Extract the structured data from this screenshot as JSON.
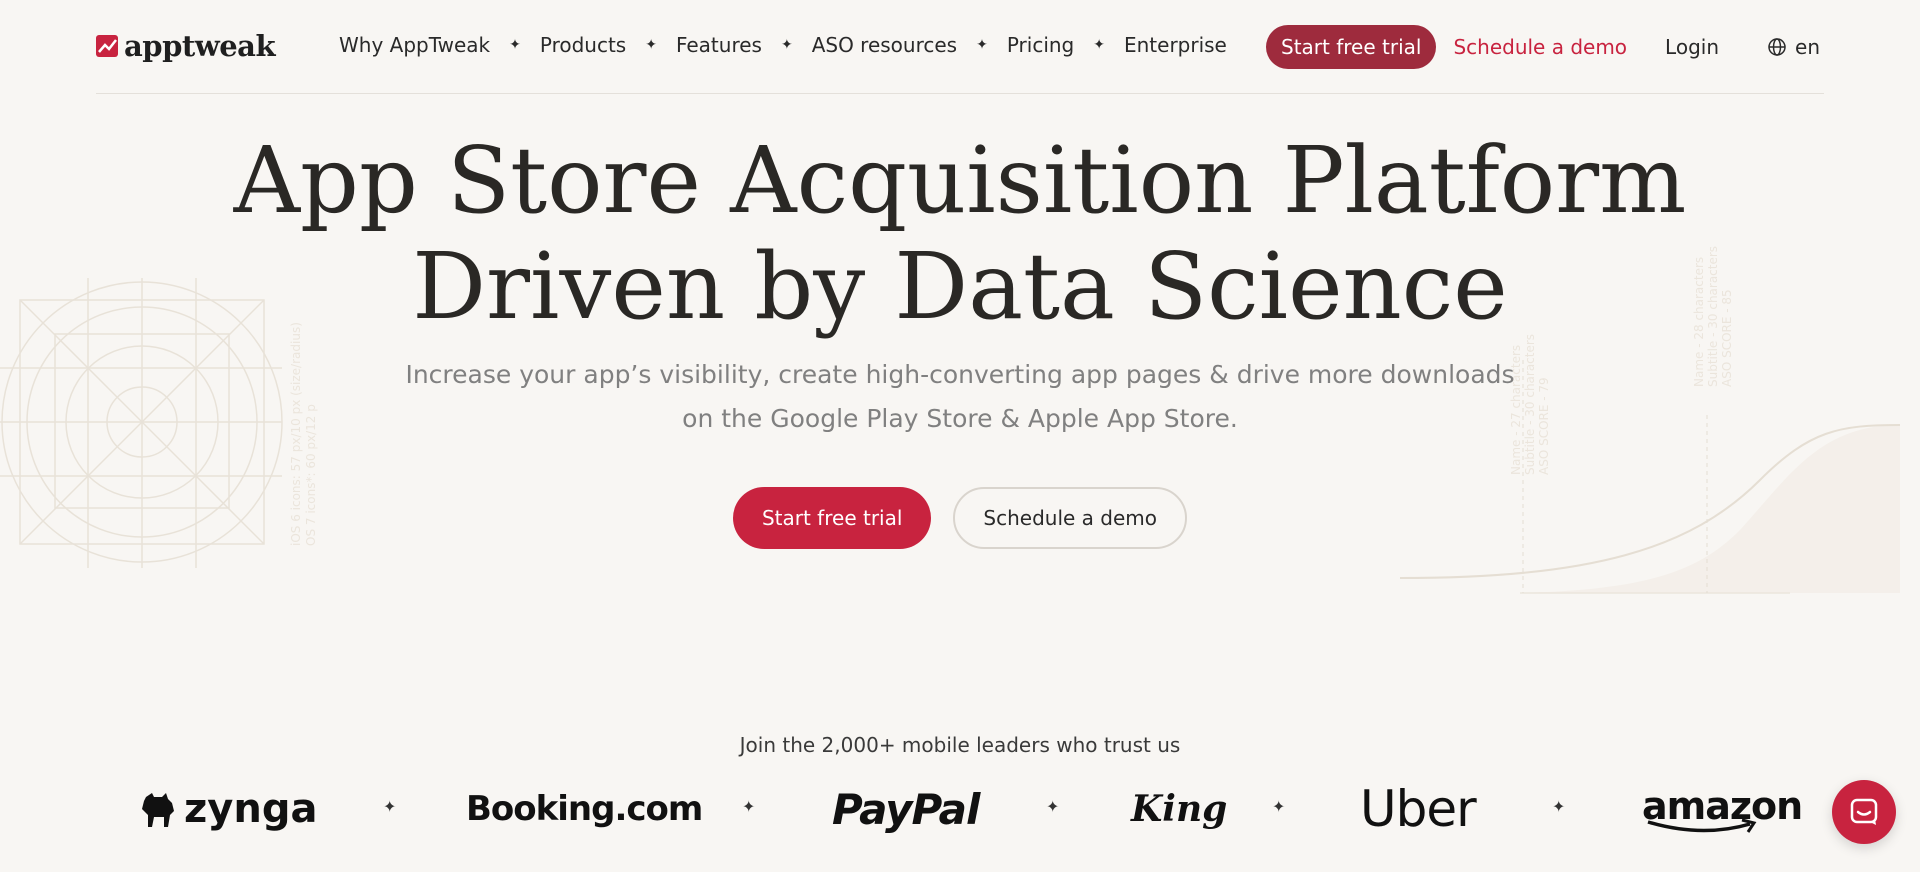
{
  "brand": {
    "name": "apptweak",
    "accent": "#c8233f",
    "accent_dark": "#9e2b3d"
  },
  "nav": {
    "items": [
      {
        "label": "Why AppTweak"
      },
      {
        "label": "Products"
      },
      {
        "label": "Features"
      },
      {
        "label": "ASO resources"
      },
      {
        "label": "Pricing"
      },
      {
        "label": "Enterprise"
      }
    ],
    "separator": "✦",
    "trial_label": "Start free trial",
    "demo_label": "Schedule a demo",
    "login_label": "Login",
    "language": "en"
  },
  "hero": {
    "title_lines": [
      "App Store Acquisition Platform",
      "Driven by Data Science"
    ],
    "subtitle_lines": [
      "Increase your app’s visibility, create high-converting app pages & drive more downloads",
      "on the Google Play Store & Apple App Store."
    ],
    "primary_cta": "Start free trial",
    "secondary_cta": "Schedule a demo"
  },
  "decor": {
    "left_vertical_lines": [
      "iOS 6 icons: 57 px/10 px (size/radius)",
      "OS 7 icons*: 60 px/12 p"
    ],
    "right_col_a": [
      "Name - 27 characters",
      "Subtitle - 30 characters",
      "ASO SCORE - 79"
    ],
    "right_col_b": [
      "Name - 28 characters",
      "Subtitle - 30 characters",
      "ASO SCORE - 85"
    ]
  },
  "trust": {
    "text": "Join the 2,000+ mobile leaders who trust us",
    "logos": [
      "zynga",
      "Booking.com",
      "PayPal",
      "King",
      "Uber",
      "amazon"
    ]
  },
  "chat": {
    "icon": "chat-icon"
  }
}
